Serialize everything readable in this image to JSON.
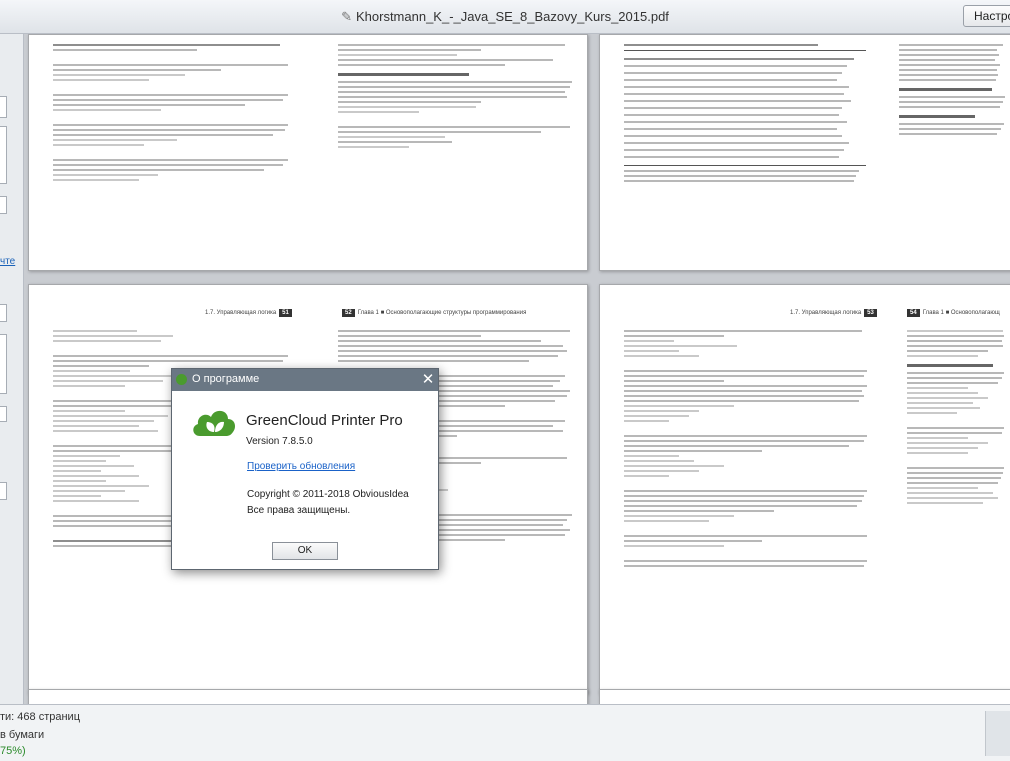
{
  "window": {
    "title": "Khorstmann_K_-_Java_SE_8_Bazovy_Kurs_2015.pdf",
    "settings_button": "Настро"
  },
  "sidebar": {
    "link_fragment": "чте"
  },
  "pages": {
    "page_51_header": "1.7. Управляющая логика",
    "page_51_number": "51",
    "page_52_number": "52",
    "page_52_header": "Глава 1 ■ Основополагающие структуры программирования",
    "page_53_header": "1.7. Управляющая логика",
    "page_53_number": "53",
    "page_54_number": "54",
    "page_54_header": "Глава 1 ■ Основополагающ"
  },
  "status": {
    "pages_line": "ти: 468 страниц",
    "paper_line": "в бумаги",
    "percent_line": "75%)"
  },
  "dialog": {
    "title": "О программе",
    "close_glyph": "✕",
    "product_name": "GreenCloud Printer Pro",
    "version": "Version 7.8.5.0",
    "check_updates": "Проверить обновления",
    "copyright": "Copyright © 2011-2018 ObviousIdea",
    "rights": "Все права защищены.",
    "ok_label": "OK"
  },
  "colors": {
    "brand_green": "#4a9b2e",
    "dialog_titlebar": "#6a7784",
    "link": "#1a62c8"
  },
  "icons": [
    "pencil-icon",
    "greencloud-logo",
    "close-icon"
  ]
}
